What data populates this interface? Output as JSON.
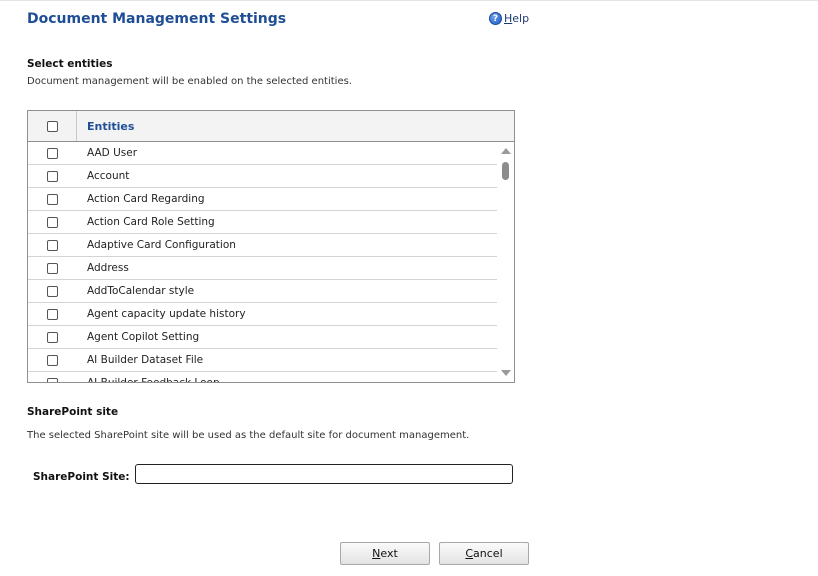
{
  "header": {
    "title": "Document Management Settings",
    "help_first": "H",
    "help_rest": "elp",
    "help_icon": "question-circle-icon",
    "help_icon_glyph": "?"
  },
  "select_entities": {
    "heading": "Select entities",
    "description": "Document management will be enabled on the selected entities."
  },
  "entities_grid": {
    "column_header": "Entities",
    "rows": [
      {
        "label": "AAD User",
        "checked": false
      },
      {
        "label": "Account",
        "checked": false
      },
      {
        "label": "Action Card Regarding",
        "checked": false
      },
      {
        "label": "Action Card Role Setting",
        "checked": false
      },
      {
        "label": "Adaptive Card Configuration",
        "checked": false
      },
      {
        "label": "Address",
        "checked": false
      },
      {
        "label": "AddToCalendar style",
        "checked": false
      },
      {
        "label": "Agent capacity update history",
        "checked": false
      },
      {
        "label": "Agent Copilot Setting",
        "checked": false
      },
      {
        "label": "AI Builder Dataset File",
        "checked": false
      },
      {
        "label": "AI Builder Feedback Loop",
        "checked": false
      }
    ]
  },
  "sharepoint": {
    "heading": "SharePoint site",
    "description": "The selected SharePoint site will be used as the default site for document management.",
    "field_label": "SharePoint Site:",
    "field_value": "",
    "field_placeholder": ""
  },
  "buttons": {
    "next_first": "N",
    "next_rest": "ext",
    "cancel_first": "C",
    "cancel_rest": "ancel"
  },
  "colors": {
    "title_blue": "#1f4e96",
    "header_bg": "#f3f3f3"
  }
}
